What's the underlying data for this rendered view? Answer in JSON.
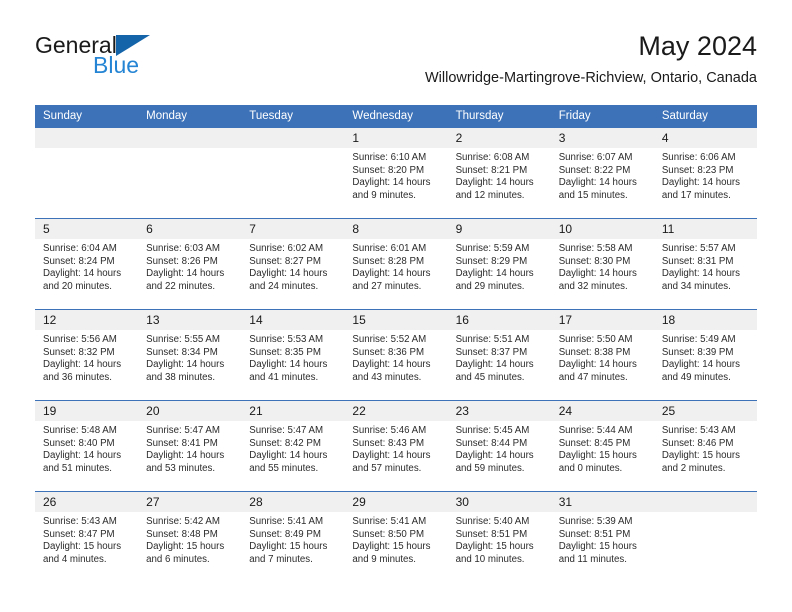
{
  "brand": {
    "line1": "General",
    "line2": "Blue",
    "triangle_color": "#1464aa",
    "blue_color": "#2585d4"
  },
  "header": {
    "title": "May 2024",
    "subtitle": "Willowridge-Martingrove-Richview, Ontario, Canada"
  },
  "colors": {
    "header_bg": "#3d72b8",
    "day_band_bg": "#f0f0f0",
    "row_divider": "#3d72b8",
    "text": "#1a1a1a"
  },
  "calendar": {
    "weekday_headers": [
      "Sunday",
      "Monday",
      "Tuesday",
      "Wednesday",
      "Thursday",
      "Friday",
      "Saturday"
    ],
    "labels": {
      "sunrise": "Sunrise:",
      "sunset": "Sunset:",
      "daylight": "Daylight:"
    },
    "weeks": [
      [
        {
          "day": "",
          "sunrise": "",
          "sunset": "",
          "daylight_l1": "",
          "daylight_l2": ""
        },
        {
          "day": "",
          "sunrise": "",
          "sunset": "",
          "daylight_l1": "",
          "daylight_l2": ""
        },
        {
          "day": "",
          "sunrise": "",
          "sunset": "",
          "daylight_l1": "",
          "daylight_l2": ""
        },
        {
          "day": "1",
          "sunrise": "Sunrise: 6:10 AM",
          "sunset": "Sunset: 8:20 PM",
          "daylight_l1": "Daylight: 14 hours",
          "daylight_l2": "and 9 minutes."
        },
        {
          "day": "2",
          "sunrise": "Sunrise: 6:08 AM",
          "sunset": "Sunset: 8:21 PM",
          "daylight_l1": "Daylight: 14 hours",
          "daylight_l2": "and 12 minutes."
        },
        {
          "day": "3",
          "sunrise": "Sunrise: 6:07 AM",
          "sunset": "Sunset: 8:22 PM",
          "daylight_l1": "Daylight: 14 hours",
          "daylight_l2": "and 15 minutes."
        },
        {
          "day": "4",
          "sunrise": "Sunrise: 6:06 AM",
          "sunset": "Sunset: 8:23 PM",
          "daylight_l1": "Daylight: 14 hours",
          "daylight_l2": "and 17 minutes."
        }
      ],
      [
        {
          "day": "5",
          "sunrise": "Sunrise: 6:04 AM",
          "sunset": "Sunset: 8:24 PM",
          "daylight_l1": "Daylight: 14 hours",
          "daylight_l2": "and 20 minutes."
        },
        {
          "day": "6",
          "sunrise": "Sunrise: 6:03 AM",
          "sunset": "Sunset: 8:26 PM",
          "daylight_l1": "Daylight: 14 hours",
          "daylight_l2": "and 22 minutes."
        },
        {
          "day": "7",
          "sunrise": "Sunrise: 6:02 AM",
          "sunset": "Sunset: 8:27 PM",
          "daylight_l1": "Daylight: 14 hours",
          "daylight_l2": "and 24 minutes."
        },
        {
          "day": "8",
          "sunrise": "Sunrise: 6:01 AM",
          "sunset": "Sunset: 8:28 PM",
          "daylight_l1": "Daylight: 14 hours",
          "daylight_l2": "and 27 minutes."
        },
        {
          "day": "9",
          "sunrise": "Sunrise: 5:59 AM",
          "sunset": "Sunset: 8:29 PM",
          "daylight_l1": "Daylight: 14 hours",
          "daylight_l2": "and 29 minutes."
        },
        {
          "day": "10",
          "sunrise": "Sunrise: 5:58 AM",
          "sunset": "Sunset: 8:30 PM",
          "daylight_l1": "Daylight: 14 hours",
          "daylight_l2": "and 32 minutes."
        },
        {
          "day": "11",
          "sunrise": "Sunrise: 5:57 AM",
          "sunset": "Sunset: 8:31 PM",
          "daylight_l1": "Daylight: 14 hours",
          "daylight_l2": "and 34 minutes."
        }
      ],
      [
        {
          "day": "12",
          "sunrise": "Sunrise: 5:56 AM",
          "sunset": "Sunset: 8:32 PM",
          "daylight_l1": "Daylight: 14 hours",
          "daylight_l2": "and 36 minutes."
        },
        {
          "day": "13",
          "sunrise": "Sunrise: 5:55 AM",
          "sunset": "Sunset: 8:34 PM",
          "daylight_l1": "Daylight: 14 hours",
          "daylight_l2": "and 38 minutes."
        },
        {
          "day": "14",
          "sunrise": "Sunrise: 5:53 AM",
          "sunset": "Sunset: 8:35 PM",
          "daylight_l1": "Daylight: 14 hours",
          "daylight_l2": "and 41 minutes."
        },
        {
          "day": "15",
          "sunrise": "Sunrise: 5:52 AM",
          "sunset": "Sunset: 8:36 PM",
          "daylight_l1": "Daylight: 14 hours",
          "daylight_l2": "and 43 minutes."
        },
        {
          "day": "16",
          "sunrise": "Sunrise: 5:51 AM",
          "sunset": "Sunset: 8:37 PM",
          "daylight_l1": "Daylight: 14 hours",
          "daylight_l2": "and 45 minutes."
        },
        {
          "day": "17",
          "sunrise": "Sunrise: 5:50 AM",
          "sunset": "Sunset: 8:38 PM",
          "daylight_l1": "Daylight: 14 hours",
          "daylight_l2": "and 47 minutes."
        },
        {
          "day": "18",
          "sunrise": "Sunrise: 5:49 AM",
          "sunset": "Sunset: 8:39 PM",
          "daylight_l1": "Daylight: 14 hours",
          "daylight_l2": "and 49 minutes."
        }
      ],
      [
        {
          "day": "19",
          "sunrise": "Sunrise: 5:48 AM",
          "sunset": "Sunset: 8:40 PM",
          "daylight_l1": "Daylight: 14 hours",
          "daylight_l2": "and 51 minutes."
        },
        {
          "day": "20",
          "sunrise": "Sunrise: 5:47 AM",
          "sunset": "Sunset: 8:41 PM",
          "daylight_l1": "Daylight: 14 hours",
          "daylight_l2": "and 53 minutes."
        },
        {
          "day": "21",
          "sunrise": "Sunrise: 5:47 AM",
          "sunset": "Sunset: 8:42 PM",
          "daylight_l1": "Daylight: 14 hours",
          "daylight_l2": "and 55 minutes."
        },
        {
          "day": "22",
          "sunrise": "Sunrise: 5:46 AM",
          "sunset": "Sunset: 8:43 PM",
          "daylight_l1": "Daylight: 14 hours",
          "daylight_l2": "and 57 minutes."
        },
        {
          "day": "23",
          "sunrise": "Sunrise: 5:45 AM",
          "sunset": "Sunset: 8:44 PM",
          "daylight_l1": "Daylight: 14 hours",
          "daylight_l2": "and 59 minutes."
        },
        {
          "day": "24",
          "sunrise": "Sunrise: 5:44 AM",
          "sunset": "Sunset: 8:45 PM",
          "daylight_l1": "Daylight: 15 hours",
          "daylight_l2": "and 0 minutes."
        },
        {
          "day": "25",
          "sunrise": "Sunrise: 5:43 AM",
          "sunset": "Sunset: 8:46 PM",
          "daylight_l1": "Daylight: 15 hours",
          "daylight_l2": "and 2 minutes."
        }
      ],
      [
        {
          "day": "26",
          "sunrise": "Sunrise: 5:43 AM",
          "sunset": "Sunset: 8:47 PM",
          "daylight_l1": "Daylight: 15 hours",
          "daylight_l2": "and 4 minutes."
        },
        {
          "day": "27",
          "sunrise": "Sunrise: 5:42 AM",
          "sunset": "Sunset: 8:48 PM",
          "daylight_l1": "Daylight: 15 hours",
          "daylight_l2": "and 6 minutes."
        },
        {
          "day": "28",
          "sunrise": "Sunrise: 5:41 AM",
          "sunset": "Sunset: 8:49 PM",
          "daylight_l1": "Daylight: 15 hours",
          "daylight_l2": "and 7 minutes."
        },
        {
          "day": "29",
          "sunrise": "Sunrise: 5:41 AM",
          "sunset": "Sunset: 8:50 PM",
          "daylight_l1": "Daylight: 15 hours",
          "daylight_l2": "and 9 minutes."
        },
        {
          "day": "30",
          "sunrise": "Sunrise: 5:40 AM",
          "sunset": "Sunset: 8:51 PM",
          "daylight_l1": "Daylight: 15 hours",
          "daylight_l2": "and 10 minutes."
        },
        {
          "day": "31",
          "sunrise": "Sunrise: 5:39 AM",
          "sunset": "Sunset: 8:51 PM",
          "daylight_l1": "Daylight: 15 hours",
          "daylight_l2": "and 11 minutes."
        },
        {
          "day": "",
          "sunrise": "",
          "sunset": "",
          "daylight_l1": "",
          "daylight_l2": ""
        }
      ]
    ]
  }
}
